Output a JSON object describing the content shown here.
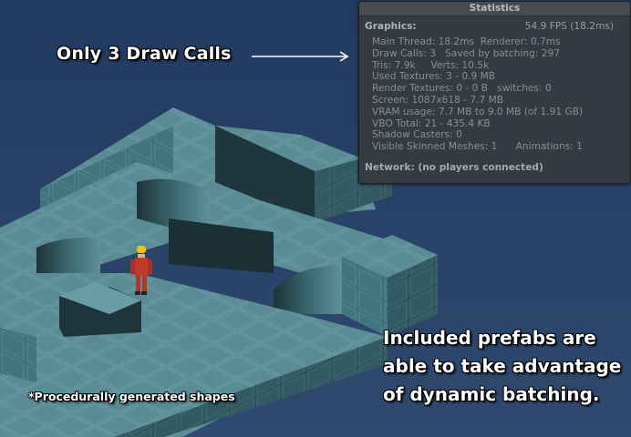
{
  "statistics_panel": {
    "title": "Statistics",
    "graphics_label": "Graphics:",
    "fps": "54.9 FPS (18.2ms)",
    "lines": [
      "Main Thread: 18.2ms  Renderer: 0.7ms",
      "Draw Calls: 3   Saved by batching: 297",
      "Tris: 7.9k     Verts: 10.5k",
      "Used Textures: 3 - 0.9 MB",
      "Render Textures: 0 - 0 B   switches: 0",
      "Screen: 1087x618 - 7.7 MB",
      "VRAM usage: 7.7 MB to 9.0 MB (of 1.91 GB)",
      "VBO Total: 21 - 435.4 KB",
      "Shadow Casters: 0",
      "Visible Skinned Meshes: 1      Animations: 1"
    ],
    "network": "Network: (no players connected)"
  },
  "captions": {
    "draw_calls": "Only 3 Draw Calls",
    "procedural": "*Procedurally generated shapes",
    "prefabs": [
      "Included prefabs are",
      "able to take advantage",
      "of dynamic batching."
    ]
  },
  "colors": {
    "background": "#2b4266",
    "tile_top": "#5e8f99",
    "tile_side_light": "#4f7f8a",
    "tile_side_dark": "#243d44",
    "character_suit": "#c0392b",
    "character_helmet": "#f1c40f"
  }
}
